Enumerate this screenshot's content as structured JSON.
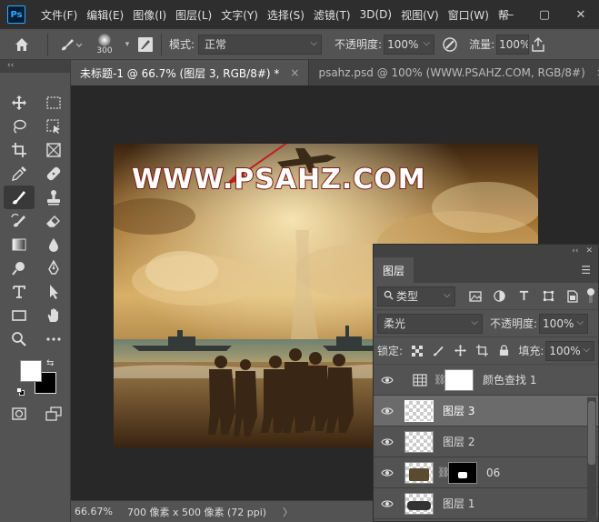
{
  "menubar": {
    "logo": "Ps",
    "items": [
      "文件(F)",
      "编辑(E)",
      "图像(I)",
      "图层(L)",
      "文字(Y)",
      "选择(S)",
      "滤镜(T)",
      "3D(D)",
      "视图(V)",
      "窗口(W)",
      "帮"
    ],
    "minimize": "—",
    "maximize": "▢",
    "close": "✕"
  },
  "options": {
    "brush_size": "300",
    "mode_label": "模式:",
    "mode_value": "正常",
    "opacity_label": "不透明度:",
    "opacity_value": "100%",
    "flow_label": "流量:",
    "flow_value": "100%"
  },
  "tabs": [
    {
      "label": "未标题-1 @ 66.7% (图层 3, RGB/8#) *",
      "close": "×"
    },
    {
      "label": "psahz.psd @ 100% (WWW.PSAHZ.COM, RGB/8#)",
      "close": "×"
    }
  ],
  "canvas": {
    "watermark": "WWW.PSAHZ.COM"
  },
  "status": {
    "zoom": "66.67%",
    "doc_info": "700 像素 x 500 像素 (72 ppi)",
    "arrow": "〉"
  },
  "layers_panel": {
    "collapse": "‹‹",
    "close": "✕",
    "tab": "图层",
    "menu": "☰",
    "filter_type": "类型",
    "blend_mode": "柔光",
    "opacity_label": "不透明度:",
    "opacity_value": "100%",
    "lock_label": "锁定:",
    "fill_label": "填充:",
    "fill_value": "100%",
    "layers": [
      {
        "name": "颜色查找 1",
        "kind": "adjustment",
        "selected": false
      },
      {
        "name": "图层 3",
        "kind": "pixel",
        "selected": true
      },
      {
        "name": "图层 2",
        "kind": "pixel",
        "selected": false
      },
      {
        "name": "06",
        "kind": "masked",
        "selected": false
      },
      {
        "name": "图层 1",
        "kind": "pixel",
        "selected": false
      }
    ]
  },
  "colors": {
    "accent": "#31a8ff",
    "watermark_stroke": "#7a1a10",
    "arrow": "#c02020"
  }
}
